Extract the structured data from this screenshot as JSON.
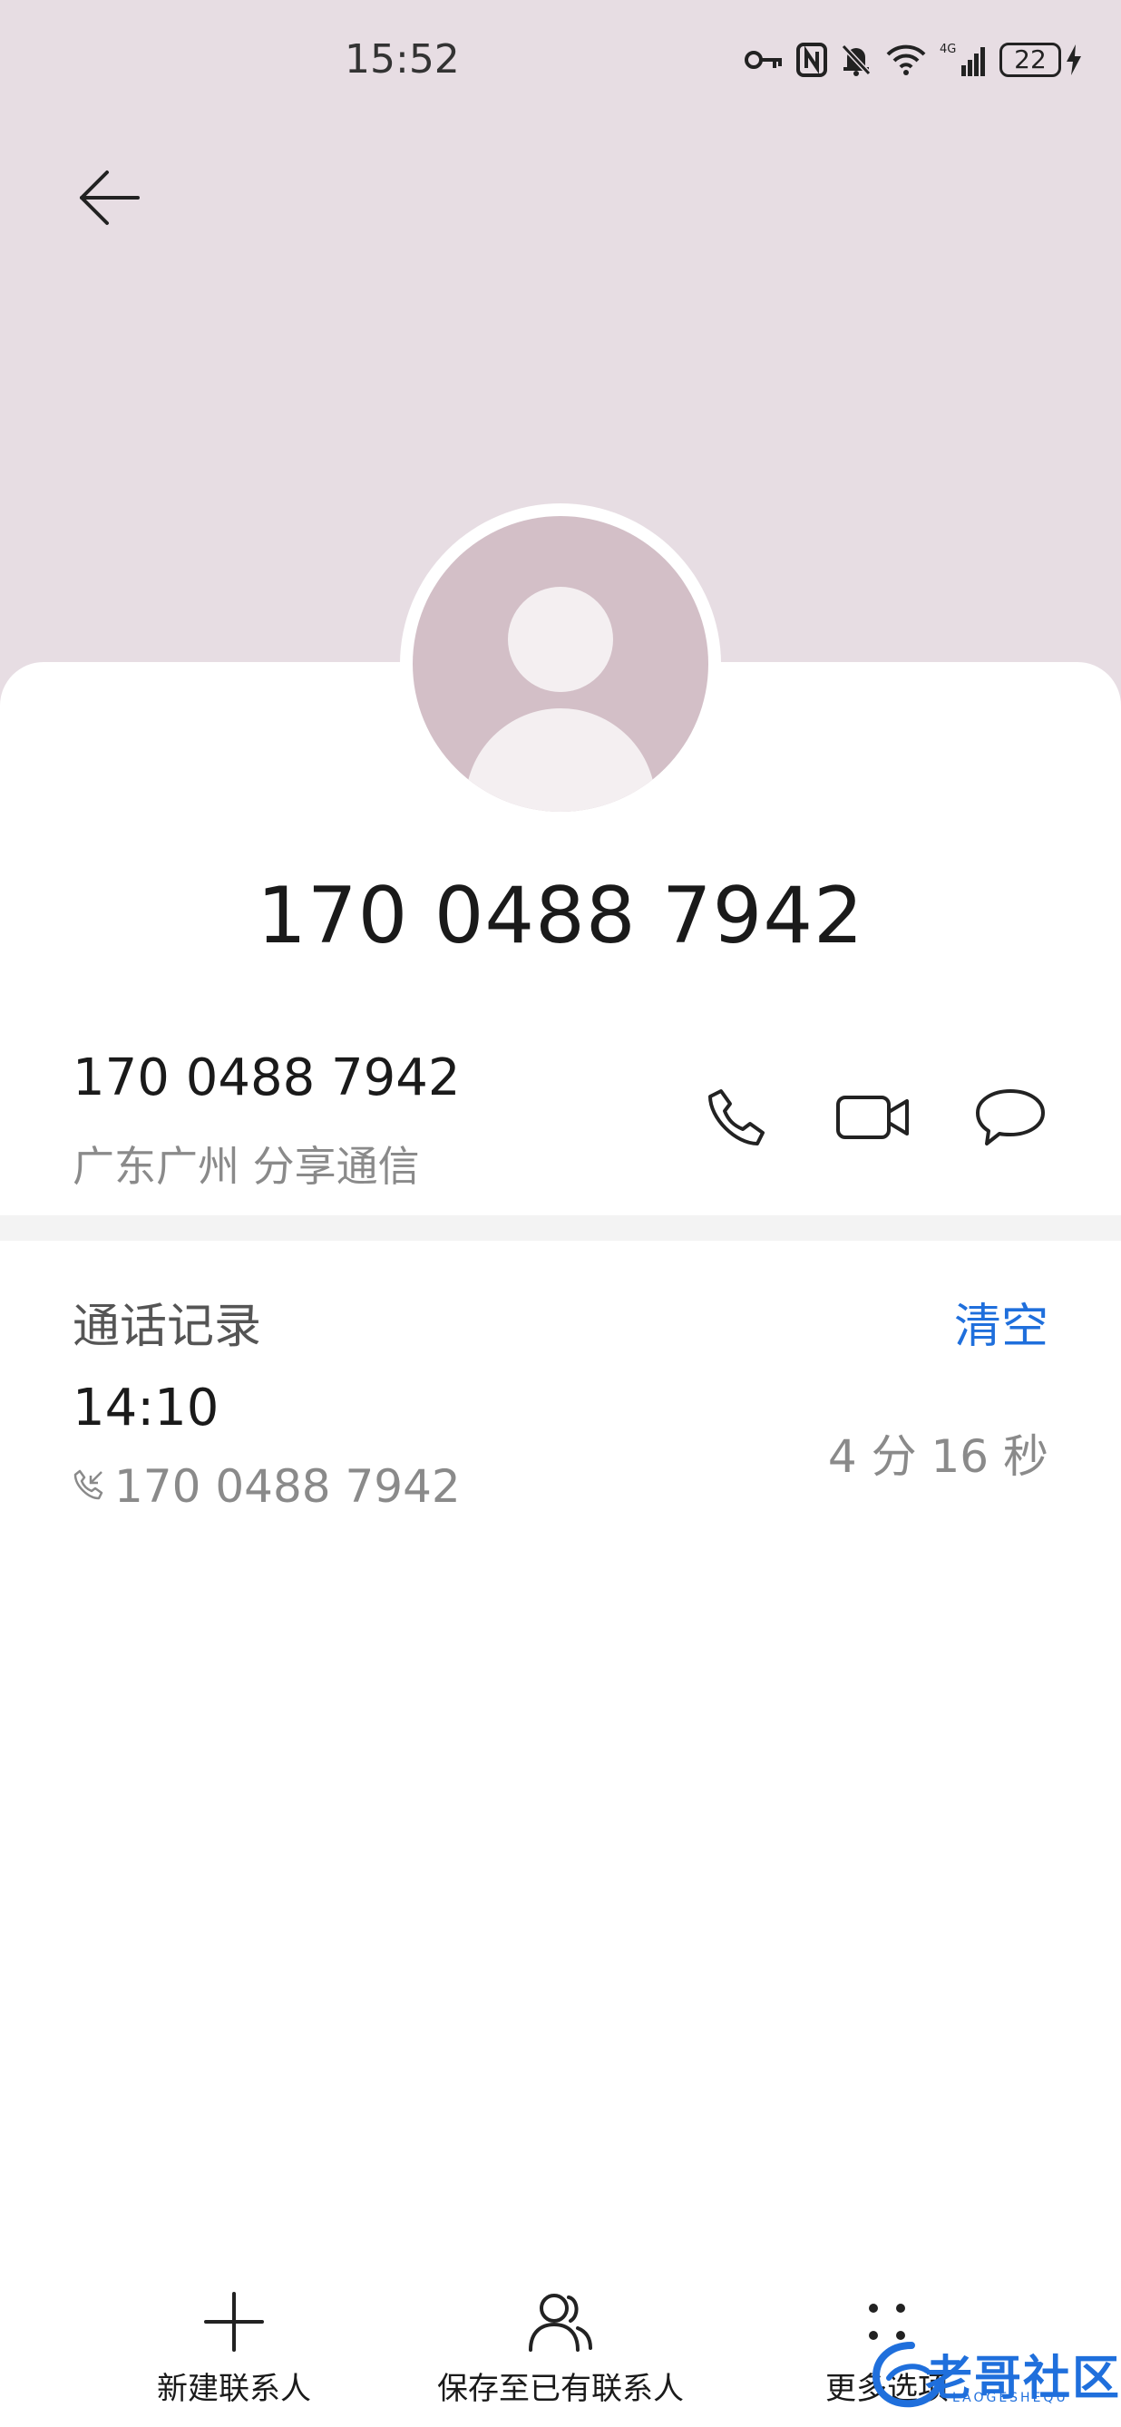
{
  "status_bar": {
    "time": "15:52",
    "network": "4G",
    "battery": "22"
  },
  "header": {
    "back_icon": "arrow-left-icon",
    "title_number": "170 0488 7942",
    "avatar_icon": "default-person-avatar"
  },
  "number_entry": {
    "number": "170 0488 7942",
    "location": "广东广州 分享通信",
    "actions": [
      "phone-icon",
      "video-call-icon",
      "message-icon"
    ]
  },
  "call_history": {
    "title": "通话记录",
    "clear_label": "清空",
    "entries": [
      {
        "time": "14:10",
        "number": "170 0488 7942",
        "duration": "4 分 16 秒",
        "type_icon": "incoming-call-icon"
      }
    ]
  },
  "bottom_bar": {
    "items": [
      {
        "label": "新建联系人",
        "icon": "plus-icon"
      },
      {
        "label": "保存至已有联系人",
        "icon": "contacts-icon"
      },
      {
        "label": "更多选项",
        "icon": "more-dots-icon"
      }
    ]
  },
  "watermark": {
    "text": "老哥社区",
    "sub": "LAOGESHEQU"
  },
  "colors": {
    "header_bg": "#e7dde3",
    "avatar": "#d3bfc7",
    "accent": "#1f6fdc"
  }
}
